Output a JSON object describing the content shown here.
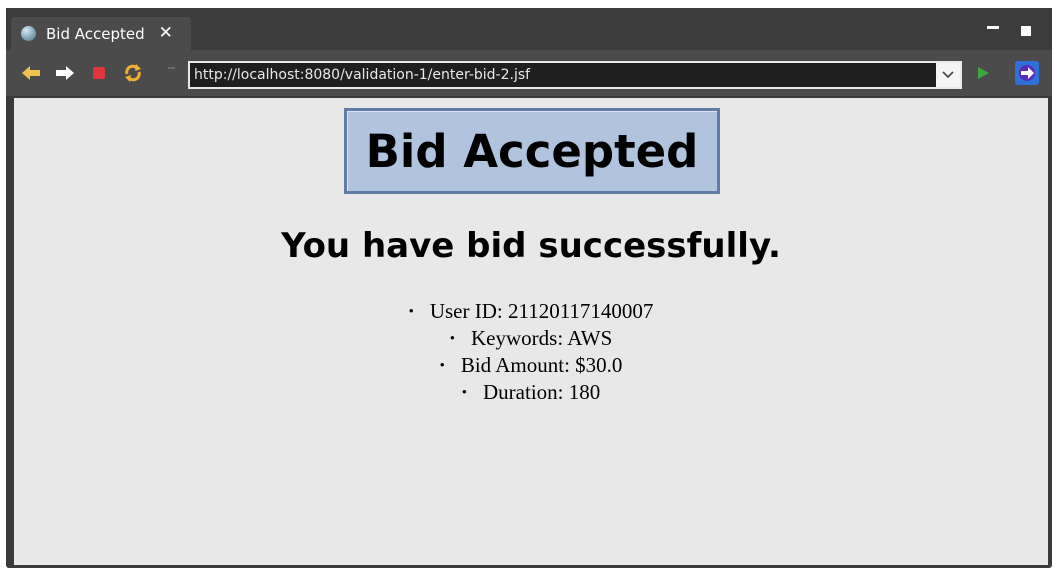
{
  "tab": {
    "title": "Bid Accepted"
  },
  "toolbar": {
    "url": "http://localhost:8080/validation-1/enter-bid-2.jsf",
    "icons": [
      "back-arrow",
      "forward-arrow",
      "stop",
      "refresh",
      "dropdown-chevron",
      "go-play",
      "web-browser-icon"
    ]
  },
  "page": {
    "heading": "Bid Accepted",
    "subheading": "You have bid successfully.",
    "items": [
      "User ID: 21120117140007",
      "Keywords: AWS",
      "Bid Amount: $30.0",
      "Duration: 180"
    ]
  },
  "colors": {
    "heading_bg": "#b0c4de",
    "heading_border": "#5f7ca5",
    "content_bg": "#e8e8e8",
    "chrome": "#4b4b4b"
  }
}
